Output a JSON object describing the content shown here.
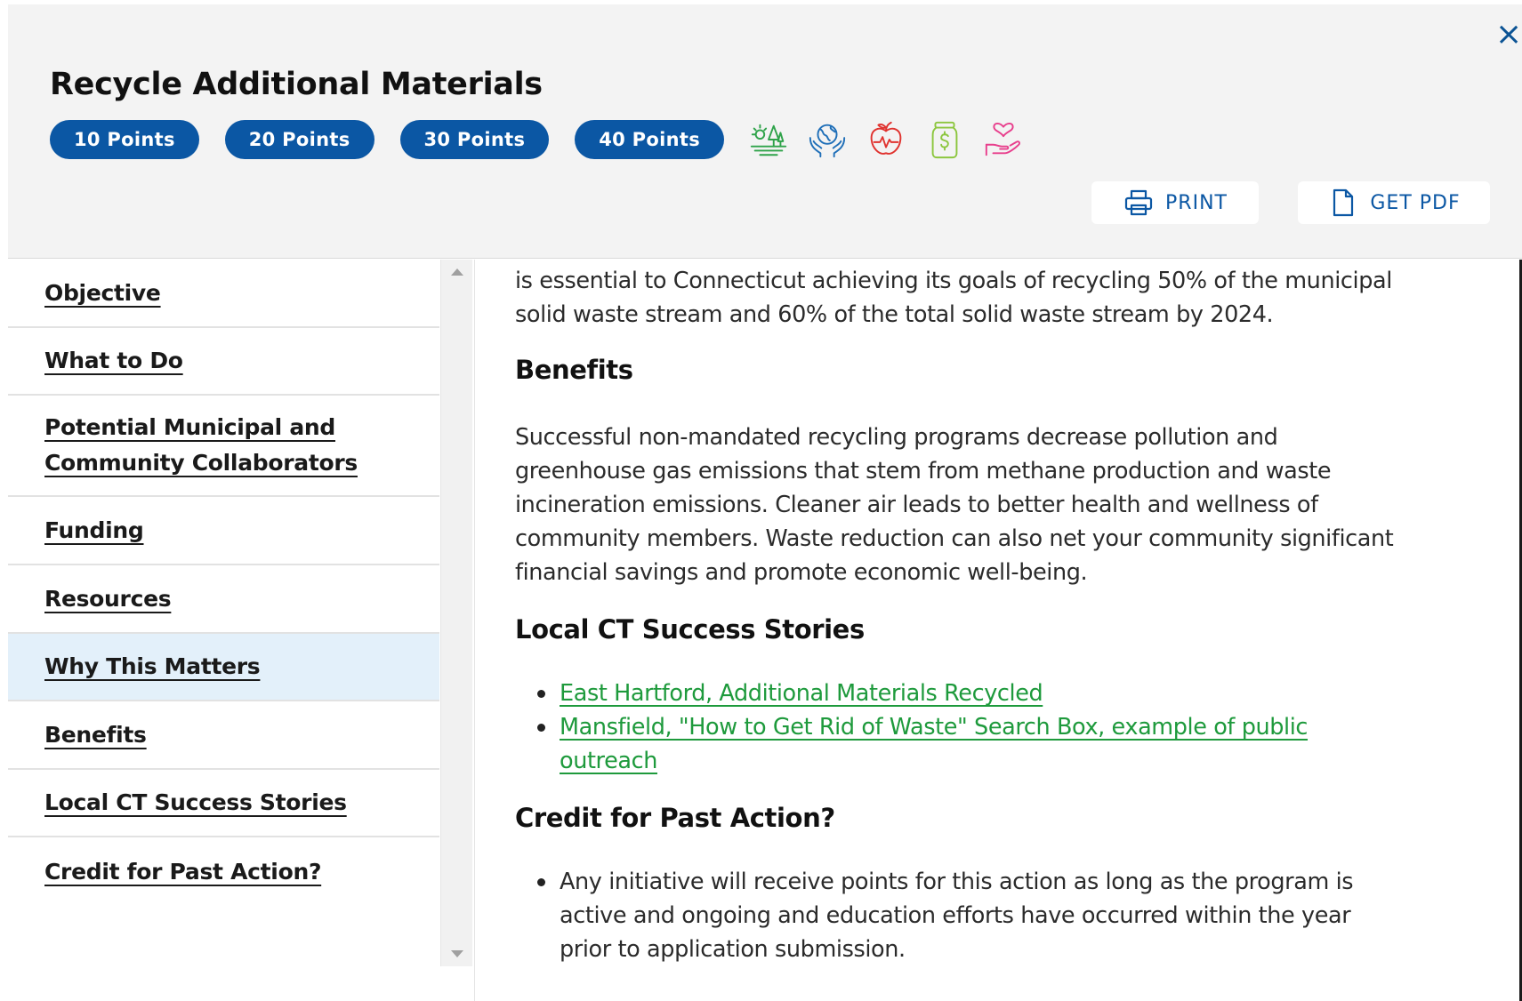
{
  "header": {
    "title": "Recycle Additional Materials",
    "close_label": "×",
    "points": [
      "10 Points",
      "20 Points",
      "30 Points",
      "40 Points"
    ],
    "category_icons": [
      {
        "name": "climate-landscape-icon",
        "color": "#2fa34a"
      },
      {
        "name": "hands-globe-icon",
        "color": "#1f6fb8"
      },
      {
        "name": "apple-health-icon",
        "color": "#e0332f"
      },
      {
        "name": "money-jar-icon",
        "color": "#8cc63e"
      },
      {
        "name": "hand-heart-icon",
        "color": "#e83e8c"
      }
    ],
    "print_label": "PRINT",
    "pdf_label": "GET PDF"
  },
  "sidebar": {
    "items": [
      {
        "label": "Objective",
        "active": false
      },
      {
        "label": "What to Do",
        "active": false
      },
      {
        "label_line1": "Potential Municipal and",
        "label_line2": "Community Collaborators",
        "active": false
      },
      {
        "label": "Funding",
        "active": false
      },
      {
        "label": "Resources",
        "active": false
      },
      {
        "label": "Why This Matters",
        "active": true
      },
      {
        "label": "Benefits",
        "active": false
      },
      {
        "label": "Local CT Success Stories",
        "active": false
      },
      {
        "label": "Credit for Past Action?",
        "active": false
      }
    ]
  },
  "content": {
    "intro_line1": "is essential to Connecticut achieving its goals of recycling 50% of the municipal",
    "intro_line2": "solid waste stream and 60% of the total solid waste stream by 2024.",
    "benefits_heading": "Benefits",
    "benefits_line1": "Successful non-mandated recycling programs decrease pollution and",
    "benefits_line2": "greenhouse gas emissions that stem from methane production and waste",
    "benefits_line3": "incineration emissions. Cleaner air leads to better health and wellness of",
    "benefits_line4": "community members. Waste reduction can also net your community significant",
    "benefits_line5": "financial savings and promote economic well-being.",
    "stories_heading": "Local CT Success Stories",
    "story_link1": "East Hartford, Additional Materials Recycled",
    "story_link2_line1": "Mansfield, \"How to Get Rid of Waste\" Search Box, example of public",
    "story_link2_line2": "outreach",
    "credit_heading": "Credit for Past Action?",
    "credit_line1": "Any initiative will receive points for this action as long as the program is",
    "credit_line2": "active and ongoing and education efforts have occurred within the year",
    "credit_line3": "prior to application submission."
  },
  "colors": {
    "pill_blue": "#0b57a4",
    "link_green": "#1e9a3c",
    "active_nav_bg": "#e3f0fa",
    "header_bg": "#f3f3f3"
  }
}
